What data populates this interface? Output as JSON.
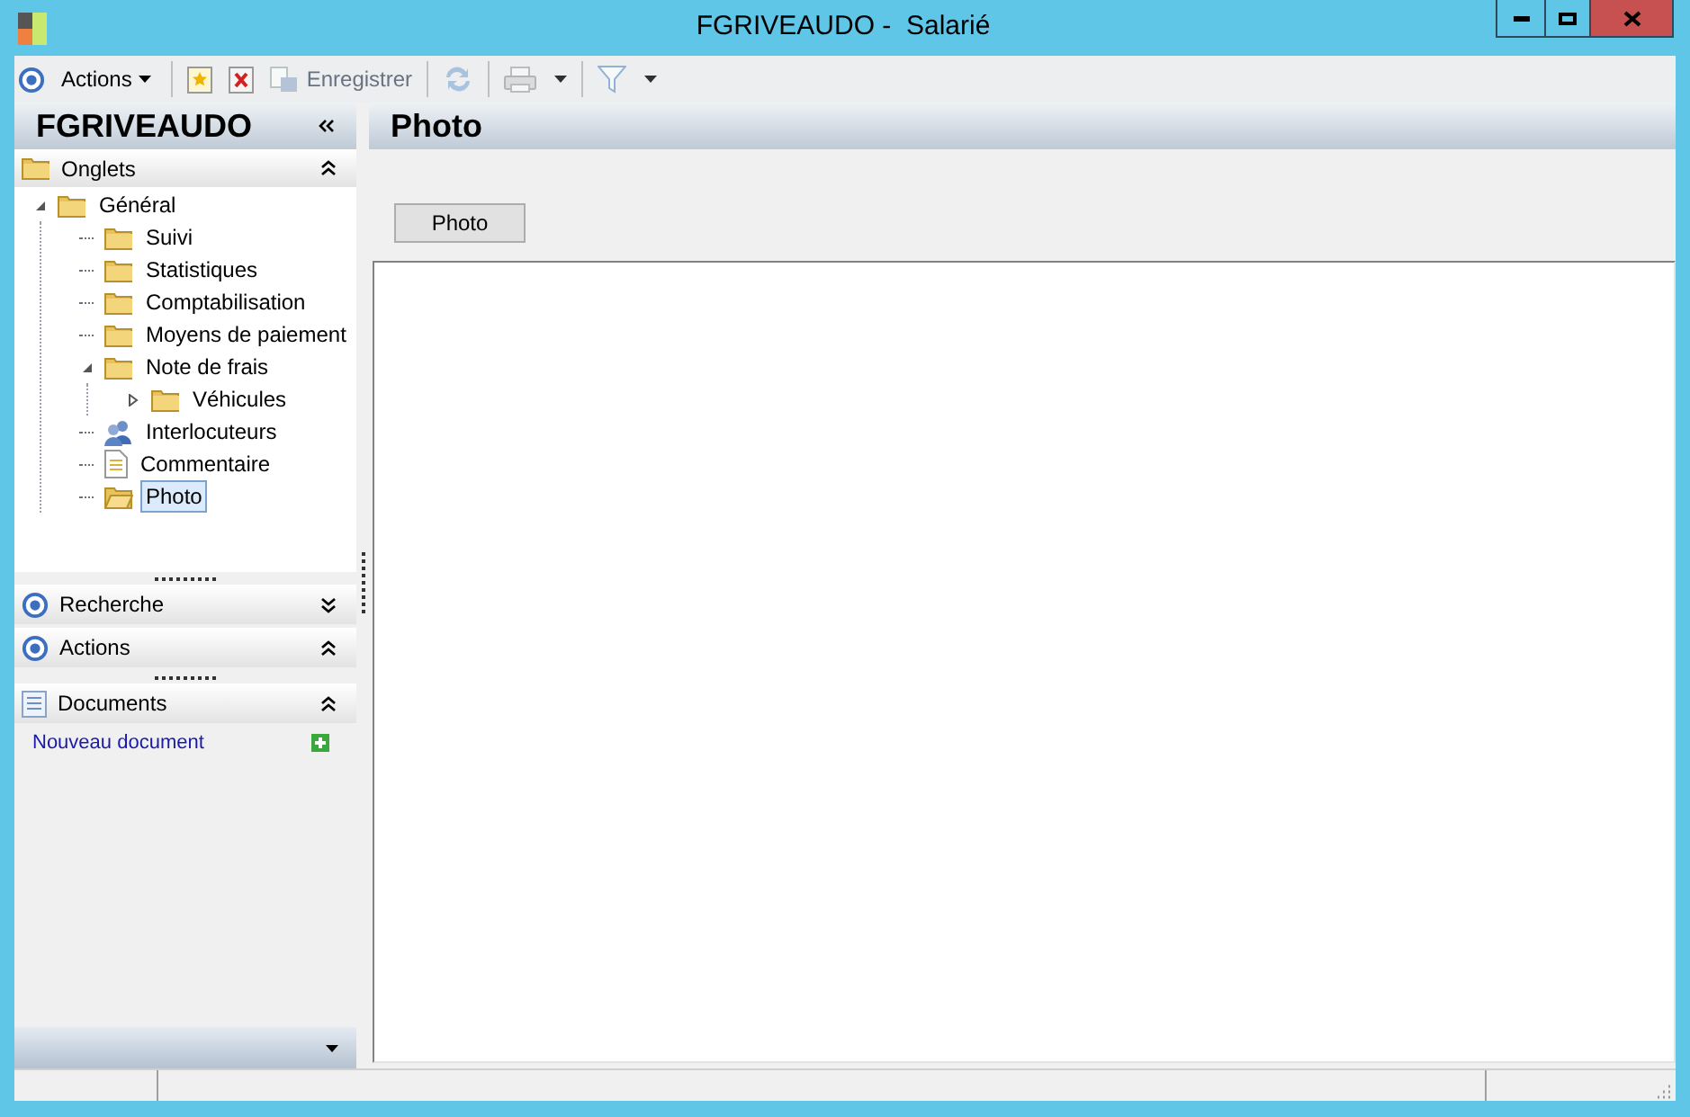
{
  "window": {
    "title": "FGRIVEAUDO -  Salarié"
  },
  "toolbar": [
    {
      "kind": "menu",
      "label": "Actions",
      "disabled": false
    },
    {
      "kind": "new",
      "disabled": false
    },
    {
      "kind": "delete",
      "disabled": false
    },
    {
      "kind": "save",
      "label": "Enregistrer",
      "disabled": true
    },
    {
      "kind": "refresh",
      "disabled": true
    },
    {
      "kind": "print",
      "disabled": true
    },
    {
      "kind": "filter",
      "disabled": true
    }
  ],
  "sidebar": {
    "title": "FGRIVEAUDO",
    "tabs_section": {
      "label": "Onglets",
      "expanded": true
    },
    "tree": [
      {
        "label": "Général",
        "kind": "folder",
        "selected": false,
        "expanded": true,
        "children": [
          {
            "label": "Suivi",
            "kind": "folder",
            "selected": false
          },
          {
            "label": "Statistiques",
            "kind": "folder",
            "selected": false
          },
          {
            "label": "Comptabilisation",
            "kind": "folder",
            "selected": false
          },
          {
            "label": "Moyens de paiement",
            "kind": "folder",
            "selected": false
          },
          {
            "label": "Note de frais",
            "kind": "folder",
            "selected": false,
            "expanded": true,
            "children": [
              {
                "label": "Véhicules",
                "kind": "folder",
                "selected": false,
                "expanded": false
              }
            ]
          },
          {
            "label": "Interlocuteurs",
            "kind": "contacts",
            "selected": false
          },
          {
            "label": "Commentaire",
            "kind": "note",
            "selected": false
          },
          {
            "label": "Photo",
            "kind": "folder-open",
            "selected": true
          }
        ]
      }
    ],
    "sections": [
      {
        "label": "Recherche",
        "expanded": false
      },
      {
        "label": "Actions",
        "expanded": true
      }
    ],
    "documents": {
      "label": "Documents",
      "expanded": true,
      "link": "Nouveau document"
    }
  },
  "main": {
    "title": "Photo",
    "button": "Photo"
  }
}
